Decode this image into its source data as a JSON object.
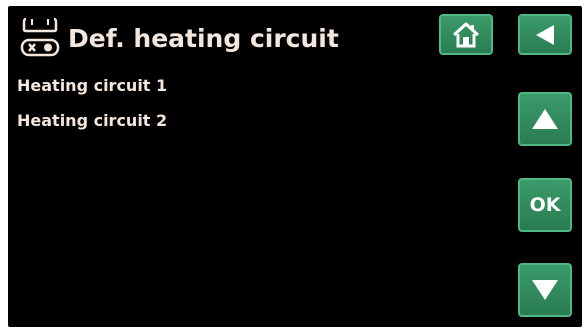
{
  "header": {
    "title": "Def. heating circuit",
    "icon": "heating-circuit-icon"
  },
  "list": {
    "items": [
      {
        "label": "Heating circuit 1"
      },
      {
        "label": "Heating circuit 2"
      }
    ]
  },
  "buttons": {
    "home": {
      "icon": "home-icon"
    },
    "back": {
      "icon": "back-arrow-icon"
    },
    "up": {
      "icon": "up-arrow-icon"
    },
    "ok": {
      "label": "OK"
    },
    "down": {
      "icon": "down-arrow-icon"
    }
  },
  "colors": {
    "background": "#000000",
    "text": "#f3e6dc",
    "button": "#2f8a5c",
    "button_border": "#4fb684"
  }
}
